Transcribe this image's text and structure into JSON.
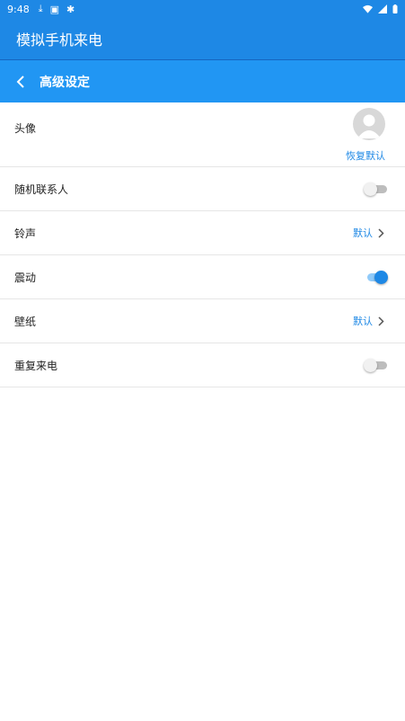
{
  "status_bar": {
    "time": "9:48",
    "icons": [
      "download-icon",
      "sim-icon",
      "bug-icon"
    ],
    "right_icons": [
      "wifi-icon",
      "signal-icon",
      "battery-icon"
    ]
  },
  "app_bar": {
    "title": "模拟手机来电"
  },
  "sub_bar": {
    "title": "高级设定"
  },
  "settings": {
    "avatar": {
      "label": "头像",
      "restore_label": "恢复默认"
    },
    "random_contact": {
      "label": "随机联系人",
      "enabled": false
    },
    "ringtone": {
      "label": "铃声",
      "value": "默认"
    },
    "vibrate": {
      "label": "震动",
      "enabled": true
    },
    "wallpaper": {
      "label": "壁纸",
      "value": "默认"
    },
    "repeat_call": {
      "label": "重复来电",
      "enabled": false
    }
  },
  "colors": {
    "primary": "#1e88e5",
    "subbar": "#2196f3",
    "accent": "#1e88e5"
  }
}
